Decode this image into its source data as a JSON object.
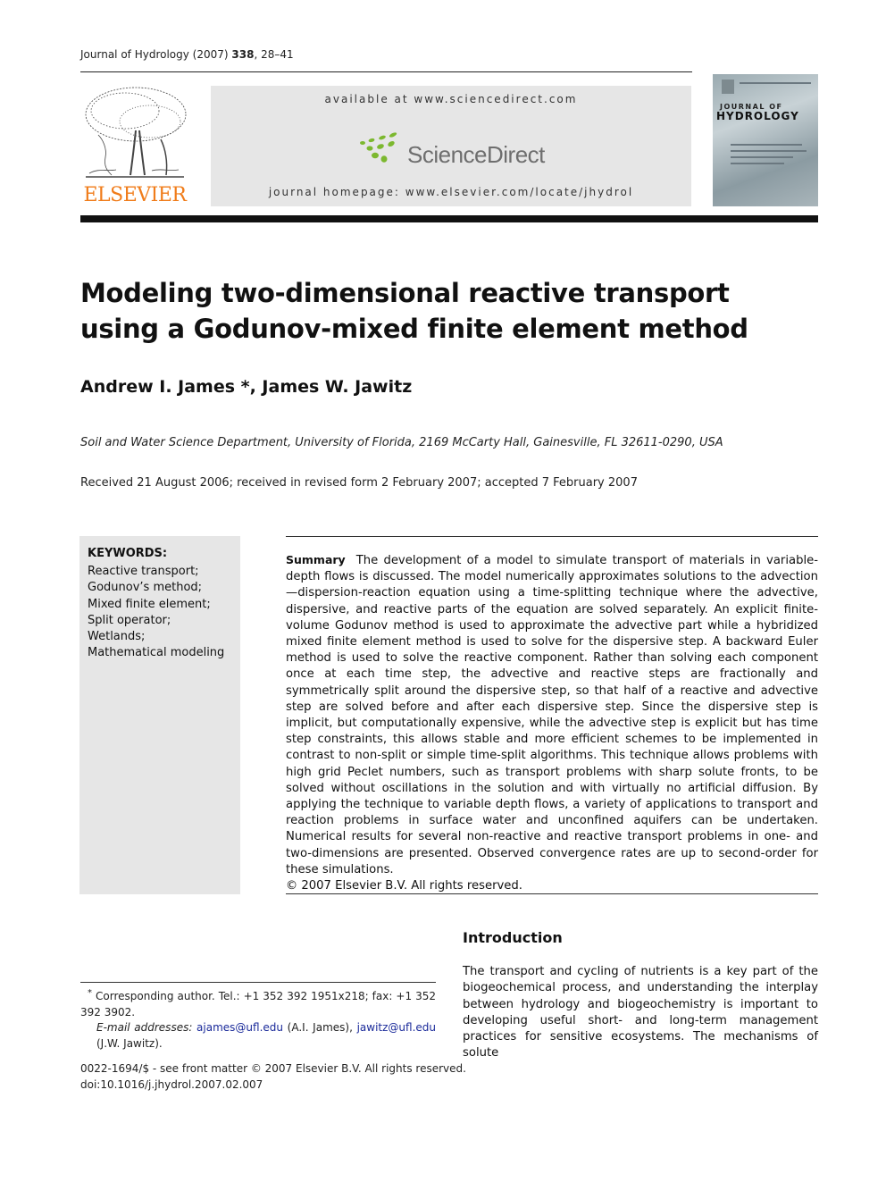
{
  "header": {
    "journal_name": "Journal of Hydrology (2007)",
    "volume": "338",
    "pages": ", 28–41",
    "available_at": "available at www.sciencedirect.com",
    "sciencedirect_brand": "ScienceDirect",
    "journal_homepage": "journal homepage: www.elsevier.com/locate/jhydrol",
    "publisher_logo_text": "ELSEVIER",
    "cover": {
      "line1": "JOURNAL OF",
      "line2": "HYDROLOGY"
    },
    "colors": {
      "elsevier_orange": "#f07c1a",
      "sciencedirect_green": "#7cb82f",
      "sciencedirect_gray": "#6e6e6e",
      "banner_bg": "#e6e6e6"
    }
  },
  "article": {
    "title": "Modeling two-dimensional reactive transport using a Godunov-mixed finite element method",
    "authors": "Andrew I. James *, James W. Jawitz",
    "affiliation": "Soil and Water Science Department, University of Florida, 2169 McCarty Hall, Gainesville, FL 32611-0290, USA",
    "received": "Received 21 August 2006; received in revised form 2 February 2007; accepted 7 February 2007"
  },
  "keywords": {
    "title": "KEYWORDS:",
    "items": [
      "Reactive transport;",
      "Godunov’s method;",
      "Mixed finite element;",
      "Split operator;",
      "Wetlands;",
      "Mathematical modeling"
    ]
  },
  "abstract": {
    "label": "Summary",
    "text": "The development of a model to simulate transport of materials in variable-depth flows is discussed. The model numerically approximates solutions to the advection—dispersion-reaction equation using a time-splitting technique where the advective, dispersive, and reactive parts of the equation are solved separately. An explicit finite-volume Godunov method is used to approximate the advective part while a hybridized mixed finite element method is used to solve for the dispersive step. A backward Euler method is used to solve the reactive component. Rather than solving each component once at each time step, the advective and reactive steps are fractionally and symmetrically split around the dispersive step, so that half of a reactive and advective step are solved before and after each dispersive step. Since the dispersive step is implicit, but computationally expensive, while the advective step is explicit but has time step constraints, this allows stable and more efficient schemes to be implemented in contrast to non-split or simple time-split algorithms. This technique allows problems with high grid Peclet numbers, such as transport problems with sharp solute fronts, to be solved without oscillations in the solution and with virtually no artificial diffusion. By applying the technique to variable depth flows, a variety of applications to transport and reaction problems in surface water and unconfined aquifers can be undertaken. Numerical results for several non-reactive and reactive transport problems in one- and two-dimensions are presented. Observed convergence rates are up to second-order for these simulations.",
    "copyright": "© 2007 Elsevier B.V. All rights reserved."
  },
  "introduction": {
    "heading": "Introduction",
    "text": "The transport and cycling of nutrients is a key part of the biogeochemical process, and understanding the interplay between hydrology and biogeochemistry is important to developing useful short- and long-term management practices for sensitive ecosystems. The mechanisms of solute"
  },
  "footnote": {
    "marker": "*",
    "corresponding": "Corresponding author. Tel.: +1 352 392 1951x218; fax: +1 352 392 3902.",
    "email_label": "E-mail addresses:",
    "email1": "ajames@ufl.edu",
    "email1_who": "(A.I. James),",
    "email2": "jawitz@ufl.edu",
    "email2_who": "(J.W. Jawitz)."
  },
  "front_matter": {
    "issn_line": "0022-1694/$ - see front matter © 2007 Elsevier B.V. All rights reserved.",
    "doi": "doi:10.1016/j.jhydrol.2007.02.007"
  }
}
